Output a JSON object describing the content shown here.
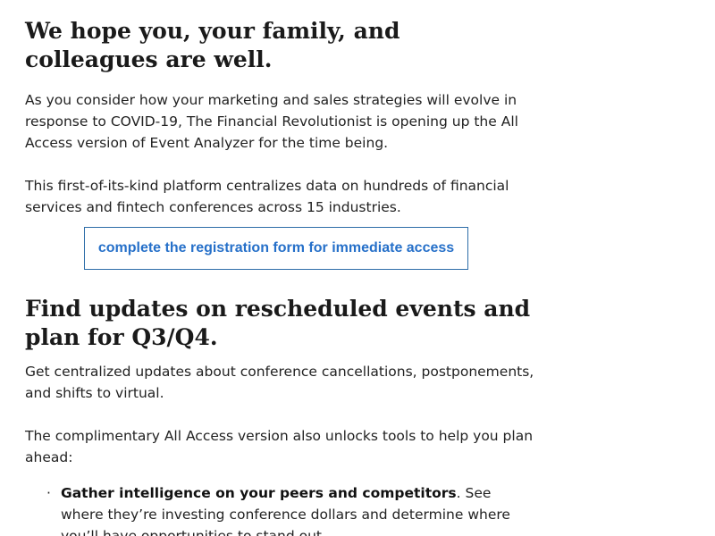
{
  "heading_1": "We hope you, your family, and colleagues are well.",
  "paragraph_1": "As you consider how your marketing and sales strategies will evolve in response to COVID-19, The Financial Revolutionist is opening up the All Access version of Event Analyzer for the time being.",
  "paragraph_2": "This first-of-its-kind platform centralizes data on hundreds of financial services and fintech conferences across 15 industries.",
  "cta": {
    "label": "complete the registration form for immediate access",
    "color": "#2670c9",
    "border_color": "#2d6da8"
  },
  "heading_2": "Find updates on rescheduled events and plan for Q3/Q4.",
  "paragraph_3": "Get centralized updates about conference cancellations, postponements, and shifts to virtual.",
  "paragraph_4": "The complimentary All Access version also unlocks tools to help you plan ahead:",
  "bullets": [
    {
      "bold": "Gather intelligence on your peers and competitors",
      "text": ". See where they’re investing conference dollars and determine where you’ll have opportunities to stand out."
    }
  ]
}
